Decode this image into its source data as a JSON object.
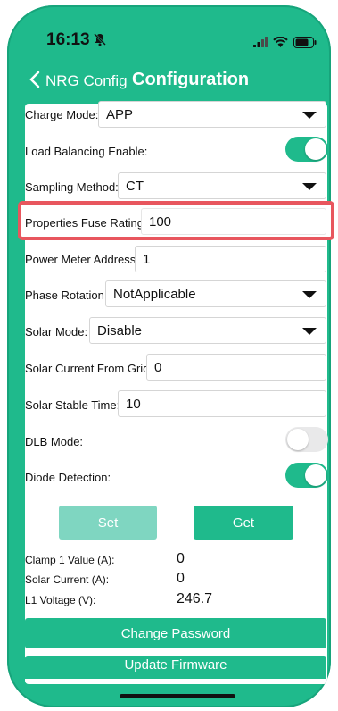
{
  "status": {
    "time": "16:13"
  },
  "nav": {
    "back_label": "NRG Config",
    "title": "Configuration"
  },
  "form": {
    "charge_mode": {
      "label": "Charge Mode:",
      "value": "APP"
    },
    "load_balancing": {
      "label": "Load Balancing Enable:",
      "on": true
    },
    "sampling_method": {
      "label": "Sampling Method:",
      "value": "CT"
    },
    "fuse_rating": {
      "label": "Properties Fuse Rating:",
      "value": "100"
    },
    "power_meter": {
      "label": "Power Meter Address:",
      "value": "1"
    },
    "phase_rotation": {
      "label": "Phase Rotation:",
      "value": "NotApplicable"
    },
    "solar_mode": {
      "label": "Solar Mode:",
      "value": "Disable"
    },
    "solar_current_grid": {
      "label": "Solar Current From Grid:",
      "value": "0"
    },
    "solar_stable_time": {
      "label": "Solar Stable Time:",
      "value": "10"
    },
    "dlb_mode": {
      "label": "DLB Mode:",
      "on": false
    },
    "diode_detection": {
      "label": "Diode Detection:",
      "on": true
    }
  },
  "buttons": {
    "set": "Set",
    "get": "Get",
    "change_password": "Change Password",
    "update_firmware": "Update Firmware"
  },
  "readings": [
    {
      "label": "Clamp 1 Value (A):",
      "value": "0"
    },
    {
      "label": "Solar Current (A):",
      "value": "0"
    },
    {
      "label": "L1 Voltage (V):",
      "value": "246.7"
    }
  ],
  "colors": {
    "accent": "#1fba8c",
    "accent_disabled": "#7fd6c1",
    "highlight": "#e8565e"
  }
}
